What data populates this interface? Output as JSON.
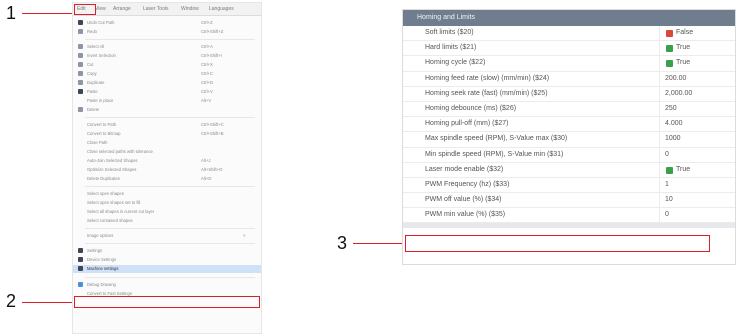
{
  "callouts": [
    "1",
    "2",
    "3"
  ],
  "colors": {
    "highlight": "#d9202a",
    "header": "#6f7d8e",
    "true_check": "#3aa14a",
    "false_check": "#d9483b",
    "selected_item": "#cfe1f7"
  },
  "menubar": [
    "Edit",
    "View",
    "Arrange",
    "Laser Tools",
    "Window",
    "Languages"
  ],
  "edit_menu": [
    {
      "label": "Undo Cut Path",
      "shortcut": "Ctrl+Z",
      "icon": "undo-icon"
    },
    {
      "label": "Redo",
      "shortcut": "Ctrl+Shift+Z",
      "icon": "redo-icon"
    },
    {
      "label": "Select All",
      "shortcut": "Ctrl+A",
      "icon": "select-all-icon"
    },
    {
      "label": "Invert Selection",
      "shortcut": "Ctrl+Shift+I",
      "icon": "invert-selection-icon"
    },
    {
      "label": "Cut",
      "shortcut": "Ctrl+X",
      "icon": "cut-icon"
    },
    {
      "label": "Copy",
      "shortcut": "Ctrl+C",
      "icon": "copy-icon"
    },
    {
      "label": "Duplicate",
      "shortcut": "Ctrl+D",
      "icon": "duplicate-icon"
    },
    {
      "label": "Paste",
      "shortcut": "Ctrl+V",
      "icon": "paste-icon"
    },
    {
      "label": "Paste in place",
      "shortcut": "Alt+V",
      "icon": "paste-in-place-icon"
    },
    {
      "label": "Delete",
      "shortcut": "",
      "icon": "delete-icon"
    },
    {
      "label": "Convert to Path",
      "shortcut": "Ctrl+Shift+C",
      "icon": ""
    },
    {
      "label": "Convert to Bitmap",
      "shortcut": "Ctrl+Shift+B",
      "icon": ""
    },
    {
      "label": "Close Path",
      "shortcut": "",
      "icon": ""
    },
    {
      "label": "Close selected paths with tolerance",
      "shortcut": "",
      "icon": ""
    },
    {
      "label": "Auto-Join Selected Shapes",
      "shortcut": "Alt+J",
      "icon": ""
    },
    {
      "label": "Optimize Selected Shapes",
      "shortcut": "Alt+Shift+O",
      "icon": ""
    },
    {
      "label": "Delete Duplicates",
      "shortcut": "Alt+D",
      "icon": ""
    },
    {
      "label": "Select open shapes",
      "shortcut": "",
      "icon": ""
    },
    {
      "label": "Select open shapes set to fill",
      "shortcut": "",
      "icon": ""
    },
    {
      "label": "Select all shapes in current cut layer",
      "shortcut": "",
      "icon": ""
    },
    {
      "label": "Select contained shapes",
      "shortcut": "",
      "icon": ""
    },
    {
      "label": "Image options",
      "shortcut": ">",
      "icon": ""
    },
    {
      "label": "Settings",
      "shortcut": "",
      "icon": "settings-icon"
    },
    {
      "label": "Device Settings",
      "shortcut": "",
      "icon": "device-settings-icon"
    },
    {
      "label": "Machine settings",
      "shortcut": "",
      "icon": "machine-settings-icon"
    },
    {
      "label": "Debug Drawing",
      "shortcut": "",
      "icon": "debug-drawing-icon"
    },
    {
      "label": "Convert to Fast Settings",
      "shortcut": "",
      "icon": ""
    }
  ],
  "settings_table": {
    "section": "Homing and Limits",
    "rows": [
      {
        "name": "Soft limits ($20)",
        "value": "False",
        "check": "off"
      },
      {
        "name": "Hard limits ($21)",
        "value": "True",
        "check": "on"
      },
      {
        "name": "Homing cycle ($22)",
        "value": "True",
        "check": "on"
      },
      {
        "name": "Homing feed rate (slow) (mm/min) ($24)",
        "value": "200.00",
        "check": ""
      },
      {
        "name": "Homing seek rate (fast) (mm/min) ($25)",
        "value": "2,000.00",
        "check": ""
      },
      {
        "name": "Homing debounce (ms) ($26)",
        "value": "250",
        "check": ""
      },
      {
        "name": "Homing pull-off (mm) ($27)",
        "value": "4.000",
        "check": ""
      },
      {
        "name": "Max spindle speed (RPM), S-Value max ($30)",
        "value": "1000",
        "check": ""
      },
      {
        "name": "Min spindle speed (RPM), S-Value min ($31)",
        "value": "0",
        "check": ""
      },
      {
        "name": "Laser mode enable ($32)",
        "value": "True",
        "check": "on"
      },
      {
        "name": "PWM Frequency (hz) ($33)",
        "value": "1",
        "check": ""
      },
      {
        "name": "PWM off value (%) ($34)",
        "value": "10",
        "check": ""
      },
      {
        "name": "PWM min value (%) ($35)",
        "value": "0",
        "check": ""
      }
    ]
  }
}
